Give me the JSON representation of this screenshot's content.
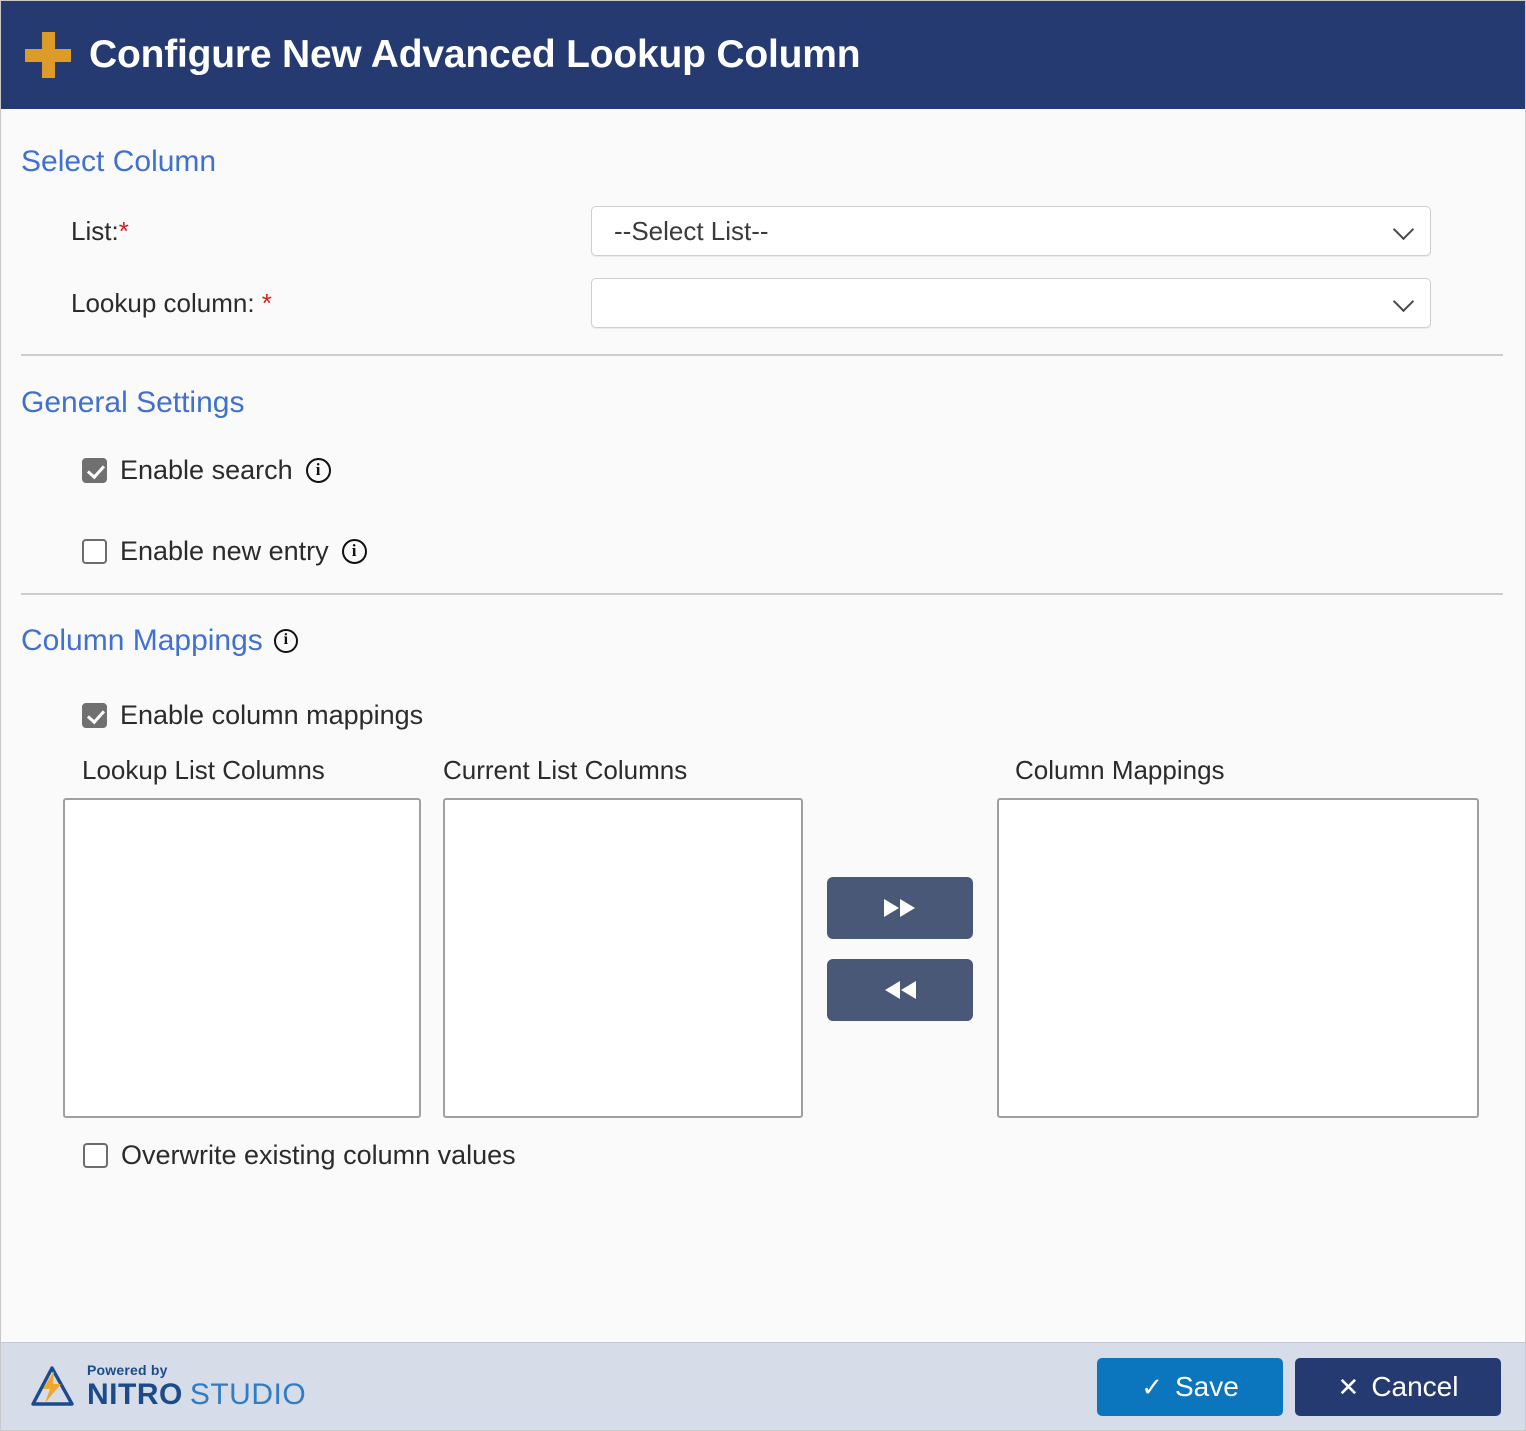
{
  "header": {
    "icon": "plus-icon",
    "title": "Configure New Advanced Lookup Column",
    "background_color": "#243a70",
    "icon_color": "#dd9b2a"
  },
  "sections": {
    "select_column": {
      "heading": "Select Column",
      "fields": [
        {
          "label": "List:",
          "required_marker": "*",
          "control": "dropdown",
          "value": "--Select List--"
        },
        {
          "label": "Lookup column: ",
          "required_marker": "*",
          "control": "dropdown",
          "value": ""
        }
      ]
    },
    "general_settings": {
      "heading": "General Settings",
      "checkboxes": [
        {
          "label": "Enable search",
          "checked": true,
          "info": "info-icon"
        },
        {
          "label": "Enable new entry",
          "checked": false,
          "info": "info-icon"
        }
      ]
    },
    "column_mappings": {
      "heading": "Column Mappings",
      "heading_info": "info-icon",
      "enable_checkbox": {
        "label": "Enable column mappings",
        "checked": true
      },
      "lists": [
        {
          "label": "Lookup List Columns",
          "items": []
        },
        {
          "label": "Current List Columns",
          "items": []
        },
        {
          "label": "Column Mappings",
          "items": []
        }
      ],
      "transfer_buttons": [
        {
          "name": "move-right-button",
          "glyph": "double-right-arrow"
        },
        {
          "name": "move-left-button",
          "glyph": "double-left-arrow"
        }
      ],
      "overwrite_checkbox": {
        "label": "Overwrite existing column values",
        "checked": false
      }
    }
  },
  "footer": {
    "logo": {
      "powered_by": "Powered by",
      "brand_bold": "NITRO",
      "brand_light": "STUDIO"
    },
    "save_glyph": "check-icon",
    "save_label": "Save",
    "cancel_glyph": "close-icon",
    "cancel_label": "Cancel",
    "save_color": "#0b76bd",
    "cancel_color": "#243a70",
    "background_color": "#d6dce8"
  },
  "theme": {
    "heading_color": "#4070d0",
    "body_background": "#fafafa",
    "transfer_button_color": "#4a5878",
    "required_color": "#e01b1b"
  }
}
